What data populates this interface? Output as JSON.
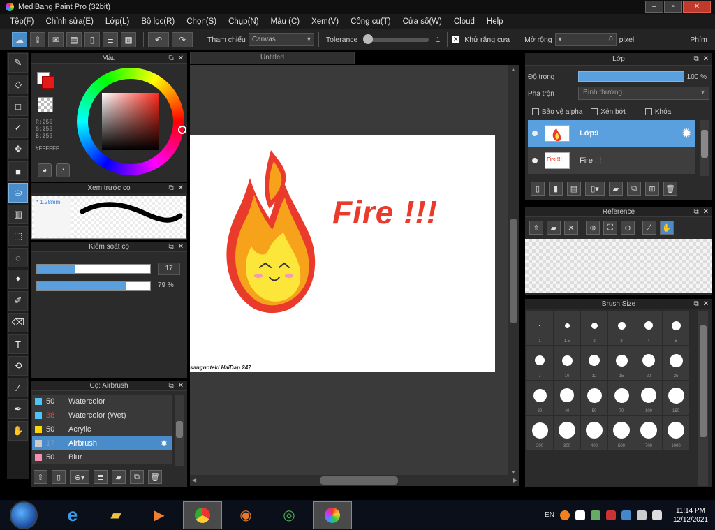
{
  "window": {
    "title": "MediBang Paint Pro (32bit)",
    "buttons": [
      "–",
      "▫",
      "✕"
    ]
  },
  "menu": [
    "Tệp(F)",
    "Chỉnh sửa(E)",
    "Lớp(L)",
    "Bộ lọc(R)",
    "Chọn(S)",
    "Chụp(N)",
    "Màu (C)",
    "Xem(V)",
    "Công cụ(T)",
    "Cửa sổ(W)",
    "Cloud",
    "Help"
  ],
  "toolbar": {
    "reference_label": "Tham chiếu",
    "reference_value": "Canvas",
    "tolerance_label": "Tolerance",
    "tolerance_value": "1",
    "antialias_label": "Khử răng cưa",
    "expand_label": "Mở rộng",
    "expand_value": "0",
    "pixel_label": "pixel",
    "right_label": "Phím"
  },
  "color_panel": {
    "title": "Màu",
    "rgb": "R:255\nG:255\nB:255",
    "hex": "#FFFFFF"
  },
  "preview_panel": {
    "title": "Xem trước cọ",
    "size_label": "1.28mm"
  },
  "control_panel": {
    "title": "Kiểm soát cọ",
    "size_value": "17",
    "size_fraction": 0.34,
    "opacity_value": "79 %",
    "opacity_fraction": 0.79
  },
  "brush_panel": {
    "title": "Cọ: Airbrush",
    "brushes": [
      {
        "size": "50",
        "name": "Watercolor",
        "color": "#4fc3f7"
      },
      {
        "size": "38",
        "name": "Watercolor (Wet)",
        "color": "#4fc3f7"
      },
      {
        "size": "50",
        "name": "Acrylic",
        "color": "#ffd600"
      },
      {
        "size": "17",
        "name": "Airbrush",
        "color": "#cccccc"
      },
      {
        "size": "50",
        "name": "Blur",
        "color": "#f48fb1"
      }
    ]
  },
  "canvas": {
    "tab": "Untitled",
    "text": "Fire !!!",
    "watermark": "sanguotekl HaiDap 247"
  },
  "layer_panel": {
    "title": "Lớp",
    "opacity_label": "Độ trong",
    "opacity_value": "100 %",
    "blend_label": "Pha trộn",
    "blend_value": "Bình thường",
    "protect_alpha": "Bảo vệ alpha",
    "clipping": "Xén bớt",
    "lock": "Khóa",
    "layers": [
      {
        "name": "Lớp9",
        "thumb_text": ""
      },
      {
        "name": "Fire !!!",
        "thumb_text": "Fire !!!"
      }
    ]
  },
  "reference_panel": {
    "title": "Reference"
  },
  "brush_size_panel": {
    "title": "Brush Size",
    "sizes": [
      "1",
      "1.5",
      "2",
      "3",
      "4",
      "5",
      "7",
      "10",
      "12",
      "15",
      "20",
      "25",
      "30",
      "40",
      "50",
      "70",
      "100",
      "150",
      "200",
      "300",
      "400",
      "500",
      "700",
      "1000"
    ]
  },
  "taskbar": {
    "lang": "EN",
    "time": "11:14 PM",
    "date": "12/12/2021"
  },
  "colors": {
    "accent": "#5ba0de",
    "fire_red": "#ea3a2c",
    "fire_orange": "#f7a21b",
    "fire_yellow": "#fde63a"
  }
}
